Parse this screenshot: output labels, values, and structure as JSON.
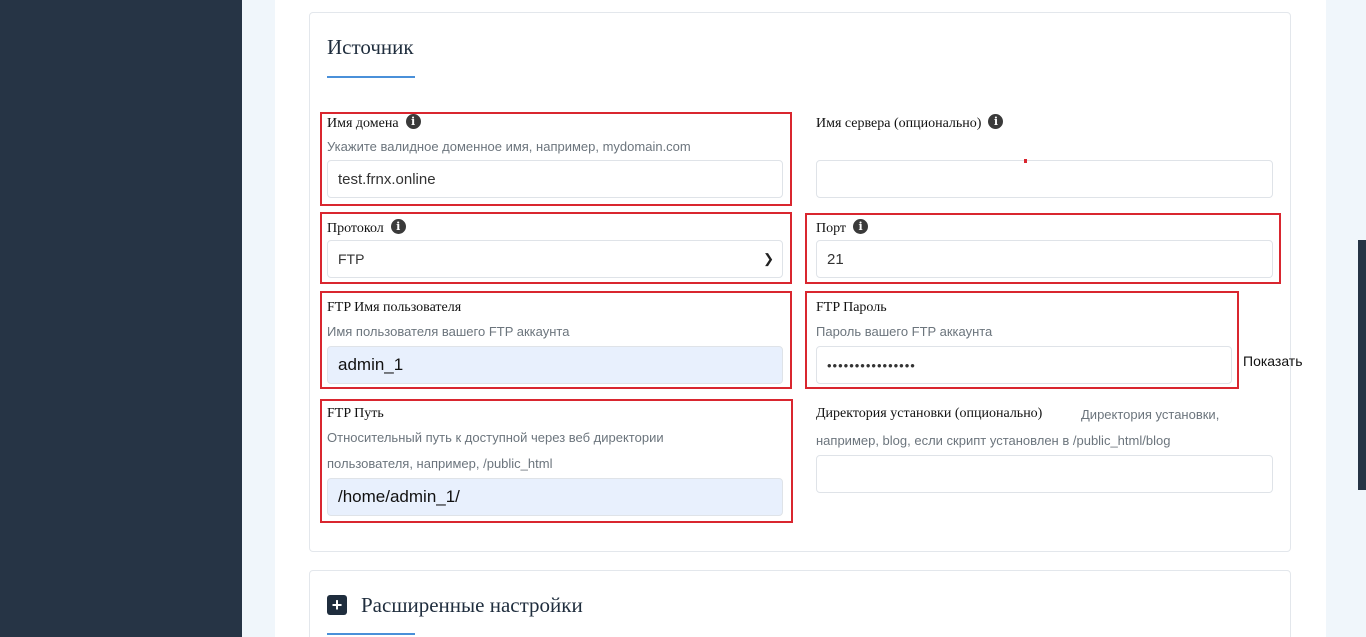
{
  "source": {
    "title": "Источник",
    "domain": {
      "label": "Имя домена",
      "help": "Укажите валидное доменное имя, например, mydomain.com",
      "value": "test.frnx.online"
    },
    "server_name": {
      "label": "Имя сервера (опционально)",
      "value": ""
    },
    "protocol": {
      "label": "Протокол",
      "value": "FTP"
    },
    "port": {
      "label": "Порт",
      "value": "21"
    },
    "ftp_user": {
      "label": "FTP Имя пользователя",
      "help": "Имя пользователя вашего FTP аккаунта",
      "value": "admin_1"
    },
    "ftp_password": {
      "label": "FTP Пароль",
      "help": "Пароль вашего FTP аккаунта",
      "value": "••••••••••••••••",
      "show_label": "Показать"
    },
    "ftp_path": {
      "label": "FTP Путь",
      "help_line1": "Относительный путь к доступной через веб директории",
      "help_line2": "пользователя, например, /public_html",
      "value": "/home/admin_1/"
    },
    "install_dir": {
      "label": "Директория установки (опционально)",
      "help_line1": "Директория установки,",
      "help_line2": "например, blog, если скрипт установлен в /public_html/blog",
      "value": ""
    }
  },
  "advanced": {
    "title": "Расширенные настройки"
  },
  "colors": {
    "sidebar": "#263445",
    "accent": "#4a90d9",
    "highlight": "#d9262f",
    "autofill": "#e8f0fd"
  }
}
